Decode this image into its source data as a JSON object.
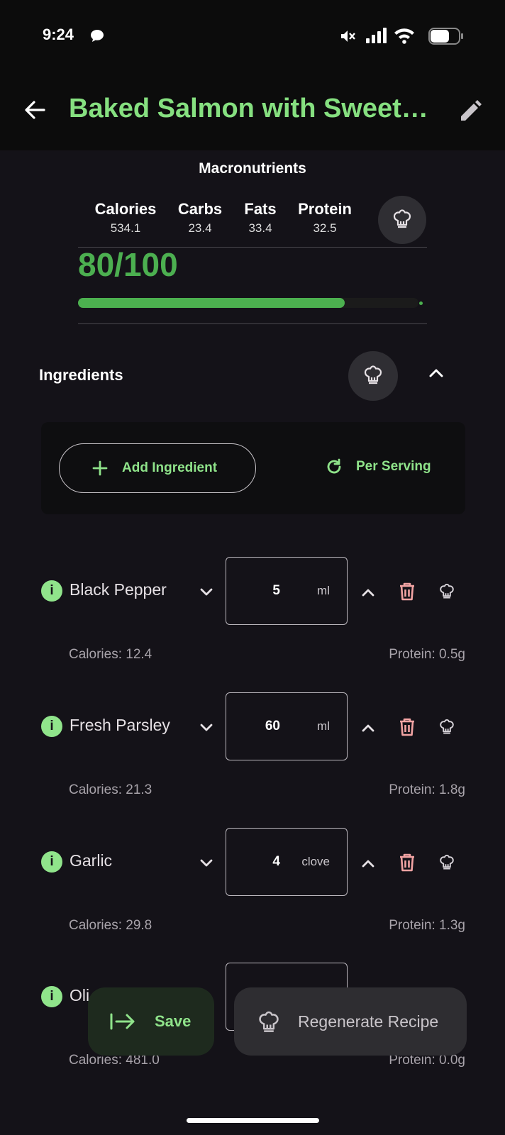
{
  "status_bar": {
    "time": "9:24"
  },
  "header": {
    "title": "Baked Salmon with Sweet…"
  },
  "macros": {
    "title": "Macronutrients",
    "items": [
      {
        "label": "Calories",
        "value": "534.1"
      },
      {
        "label": "Carbs",
        "value": "23.4"
      },
      {
        "label": "Fats",
        "value": "33.4"
      },
      {
        "label": "Protein",
        "value": "32.5"
      }
    ],
    "score": "80/100",
    "score_progress": 0.8
  },
  "ingredients_section": {
    "title": "Ingredients",
    "add_label": "Add Ingredient",
    "per_serving_label": "Per Serving"
  },
  "ingredients": [
    {
      "name": "Black Pepper",
      "qty": "5",
      "unit": "ml",
      "calories": "Calories: 12.4",
      "protein": "Protein: 0.5g"
    },
    {
      "name": "Fresh Parsley",
      "qty": "60",
      "unit": "ml",
      "calories": "Calories: 21.3",
      "protein": "Protein: 1.8g"
    },
    {
      "name": "Garlic",
      "qty": "4",
      "unit": "clove",
      "calories": "Calories: 29.8",
      "protein": "Protein: 1.3g"
    },
    {
      "name": "Oli",
      "qty": "",
      "unit": "",
      "calories": "Calories: 481.0",
      "protein": "Protein: 0.0g"
    }
  ],
  "actions": {
    "save_label": "Save",
    "regenerate_label": "Regenerate Recipe"
  },
  "colors": {
    "accent": "#86E080",
    "progress": "#4CB04F",
    "delete": "#F2A3A3",
    "background": "#141218"
  }
}
